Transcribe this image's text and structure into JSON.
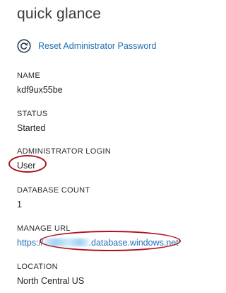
{
  "panel": {
    "title": "quick glance",
    "reset_link": "Reset Administrator Password",
    "fields": [
      {
        "label": "NAME",
        "value": "kdf9ux55be"
      },
      {
        "label": "STATUS",
        "value": "Started"
      },
      {
        "label": "ADMINISTRATOR LOGIN",
        "value": "User"
      },
      {
        "label": "DATABASE COUNT",
        "value": "1"
      },
      {
        "label": "MANAGE URL",
        "value_prefix": "https://",
        "value_suffix": ".database.windows.net"
      },
      {
        "label": "LOCATION",
        "value": "North Central US"
      }
    ]
  },
  "icons": {
    "reset": "refresh-circle-icon"
  },
  "colors": {
    "link": "#1f6fb2",
    "highlight": "#b0121b"
  }
}
